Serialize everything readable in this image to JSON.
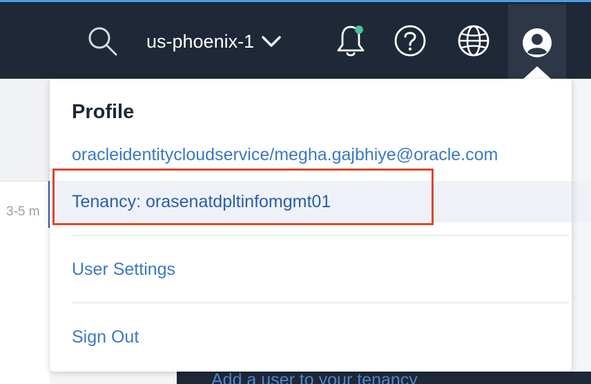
{
  "header": {
    "region": "us-phoenix-1",
    "icons": {
      "search": "search-icon",
      "region_dropdown": "chevron-down-icon",
      "notifications": "bell-icon",
      "help": "help-circle-icon",
      "language": "globe-icon",
      "profile": "user-avatar-icon"
    },
    "notification_dot_color": "#4bc29a"
  },
  "background": {
    "card_text": "3-5 m",
    "bottom_link": "Add a user to your tenancy"
  },
  "profile_menu": {
    "heading": "Profile",
    "user": "oracleidentitycloudservice/megha.gajbhiye@oracle.com",
    "tenancy": "Tenancy: orasenatdpltinfomgmt01",
    "items": [
      {
        "label": "User Settings"
      },
      {
        "label": "Sign Out"
      }
    ]
  },
  "colors": {
    "nav_bg": "#1f2836",
    "link": "#3b78c4",
    "highlight_box": "#e0452c"
  }
}
